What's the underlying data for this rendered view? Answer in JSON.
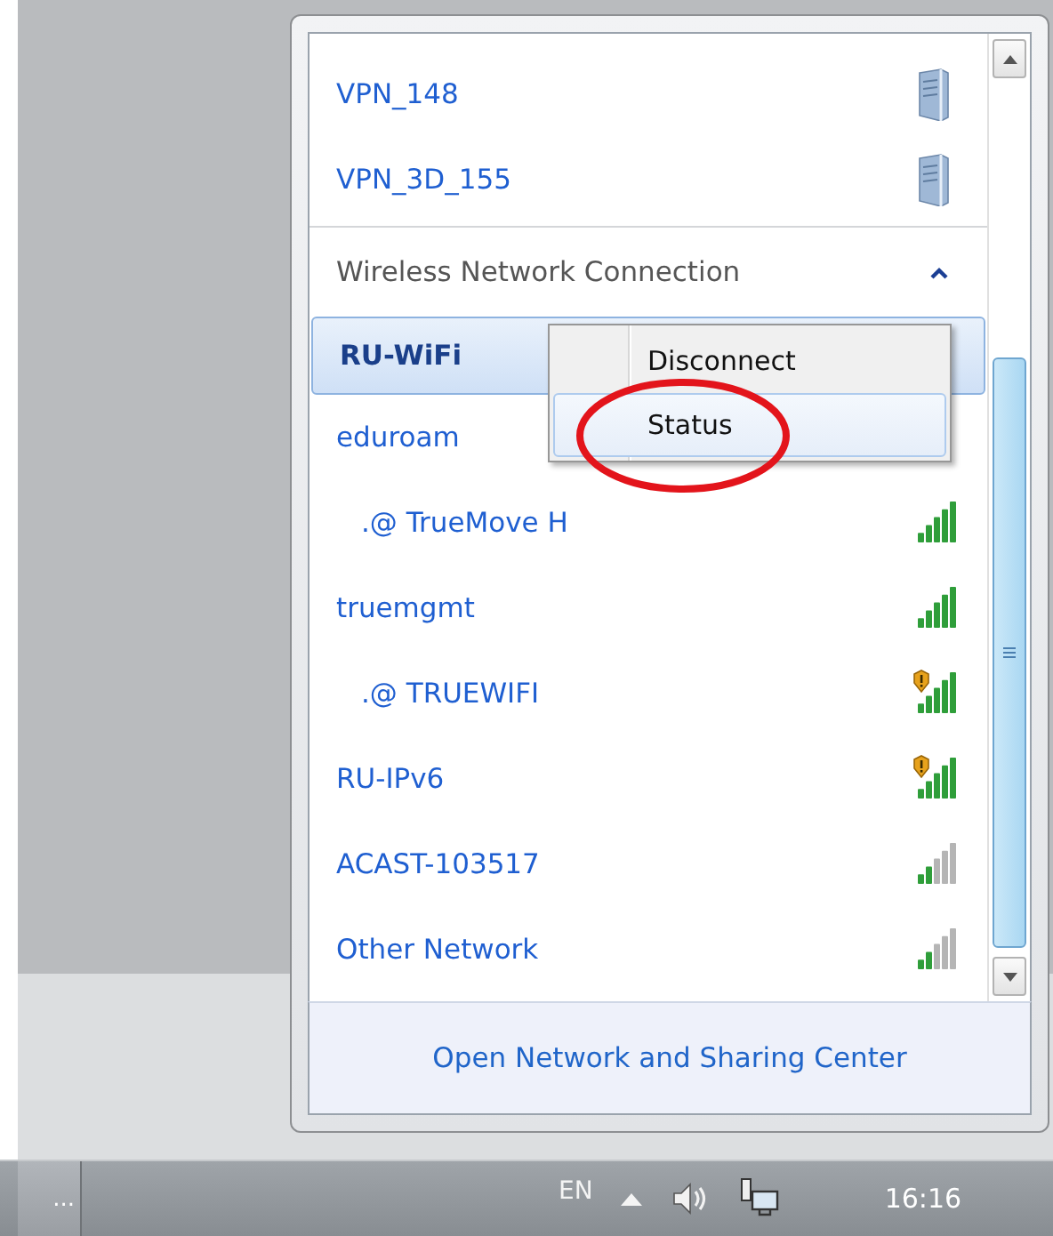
{
  "vpn_connections": [
    {
      "kind": "vpn",
      "name": "VPN_148"
    },
    {
      "kind": "vpn",
      "name": "VPN_3D_155"
    }
  ],
  "section": {
    "title": "Wireless Network Connection",
    "expanded": true
  },
  "wireless_networks": [
    {
      "name": "RU-WiFi",
      "selected": true,
      "indented": false
    },
    {
      "name": "eduroam",
      "selected": false,
      "indented": false
    },
    {
      "name": ".@ TrueMove H",
      "selected": false,
      "indented": true,
      "weak_signal": false,
      "warning": false
    },
    {
      "name": "truemgmt",
      "selected": false,
      "indented": false,
      "weak_signal": false,
      "warning": false
    },
    {
      "name": ".@ TRUEWIFI",
      "selected": false,
      "indented": true,
      "weak_signal": false,
      "warning": true
    },
    {
      "name": "RU-IPv6",
      "selected": false,
      "indented": false,
      "weak_signal": false,
      "warning": true
    },
    {
      "name": "ACAST-103517",
      "selected": false,
      "indented": false,
      "weak_signal": true,
      "warning": false
    },
    {
      "name": "Other Network",
      "selected": false,
      "indented": false,
      "weak_signal": true,
      "warning": false
    }
  ],
  "context_menu": [
    {
      "label": "Disconnect",
      "highlighted": false
    },
    {
      "label": "Status",
      "highlighted": true
    }
  ],
  "footer_link": "Open Network and Sharing Center",
  "taskbar": {
    "button": "...",
    "language": "EN",
    "clock": "16:16"
  }
}
